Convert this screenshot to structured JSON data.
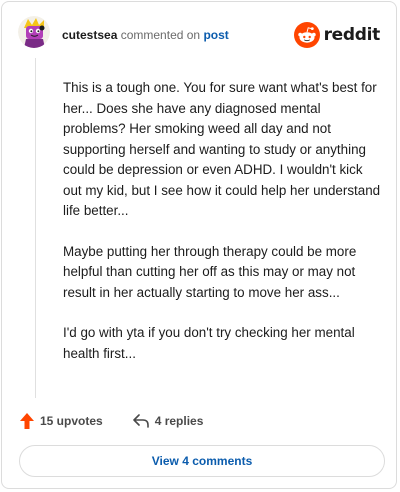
{
  "comment": {
    "username": "cutestsea",
    "action_text": "commented on",
    "post_link": "post",
    "paragraphs": [
      "This is a tough one. You for sure want what's best for her... Does she have any diagnosed mental problems? Her smoking weed all day and not supporting herself and wanting to study or anything could be depression or even ADHD. I wouldn't kick out my kid, but I see how it could help her understand life better...",
      "Maybe putting her through therapy could be more helpful than cutting her off as this may or may not result in her actually starting to move her ass...",
      "I'd go with yta if you don't try checking her mental health first..."
    ]
  },
  "logo": {
    "wordmark": "reddit",
    "brand_color": "#ff4500"
  },
  "stats": {
    "upvotes": "15 upvotes",
    "replies": "4 replies",
    "upvote_color": "#ff4500"
  },
  "footer": {
    "view_comments": "View 4 comments"
  },
  "colors": {
    "link": "#0b5cad",
    "text": "#1c1c1c",
    "muted": "#6b6b6b",
    "border": "#dcdcdc"
  }
}
